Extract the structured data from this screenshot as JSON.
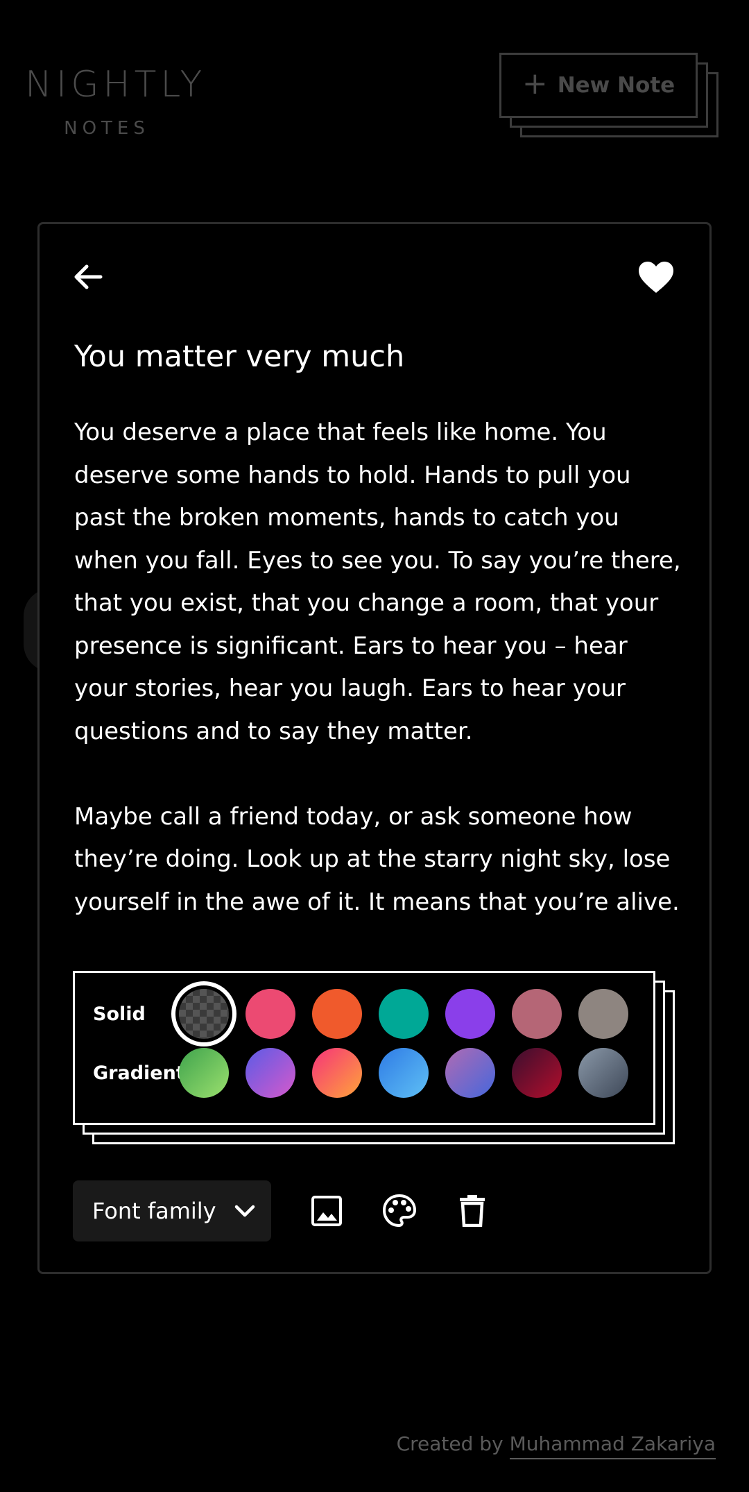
{
  "header": {
    "logo_main": "NIGHTLY",
    "logo_sub": "NOTES",
    "new_note_plus": "+",
    "new_note_label": "New Note"
  },
  "note": {
    "back_icon": "arrow-left-icon",
    "favorite_icon": "heart-icon",
    "favorited": true,
    "title": "You matter very much",
    "paragraphs": [
      "You deserve a place that feels like home. You deserve some hands to hold. Hands to pull you past the broken moments, hands to catch you when you fall. Eyes to see you. To say you’re there, that you exist, that you change a room, that your presence is significant. Ears to hear you – hear your stories, hear you laugh. Ears to hear your questions and to say they matter.",
      "Maybe call a friend today, or ask someone how they’re doing. Look up at the starry night sky, lose yourself in the awe of it. It means that you’re alive."
    ]
  },
  "picker": {
    "solid_label": "Solid",
    "gradient_label": "Gradient",
    "solid_colors": [
      "transparent",
      "#EC4A72",
      "#F05A2C",
      "#00A896",
      "#8A3FEA",
      "#B56676",
      "#8E8580"
    ],
    "gradient_colors": [
      [
        "#3FA34D",
        "#9BE06E"
      ],
      [
        "#5B5BE6",
        "#D65ACB"
      ],
      [
        "#F5337A",
        "#FFA43A"
      ],
      [
        "#2F7BE5",
        "#5FC0F5"
      ],
      [
        "#B06AB3",
        "#4568DC"
      ],
      [
        "#3A0F2E",
        "#B30D2C"
      ],
      [
        "#8A98A8",
        "#3E4858"
      ]
    ],
    "selected_solid_index": 0
  },
  "toolbar": {
    "font_family_label": "Font family",
    "icons": [
      "image-icon",
      "palette-icon",
      "trash-icon"
    ]
  },
  "footer": {
    "prefix": "Created by",
    "author": "Muhammad Zakariya"
  }
}
